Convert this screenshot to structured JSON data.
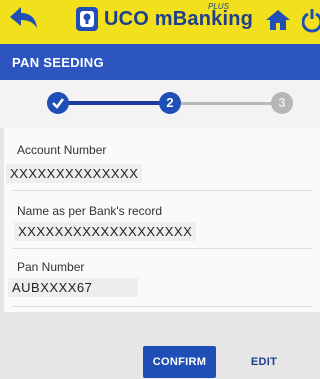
{
  "app": {
    "title": "UCO mBanking",
    "title_superscript": "PLUS",
    "brand_color": "#f2e01c",
    "accent_color": "#1f4fb6"
  },
  "icons": {
    "back": "back-arrow-icon",
    "logo": "uco-logo-icon",
    "home": "home-icon",
    "power": "power-icon",
    "step_done": "checkmark-icon"
  },
  "section": {
    "title": "PAN SEEDING"
  },
  "stepper": {
    "steps": [
      {
        "label": "✓",
        "state": "done"
      },
      {
        "label": "2",
        "state": "active"
      },
      {
        "label": "3",
        "state": "pending"
      }
    ]
  },
  "form": {
    "account_number_label": "Account Number",
    "account_number_value": "XXXXXXXXXXXXXX",
    "name_label": "Name as per Bank's record",
    "name_value": "XXXXXXXXXXXXXXXXXXX",
    "pan_label": "Pan Number",
    "pan_value": "AUBXXXX67"
  },
  "actions": {
    "confirm_label": "CONFIRM",
    "edit_label": "EDIT"
  }
}
